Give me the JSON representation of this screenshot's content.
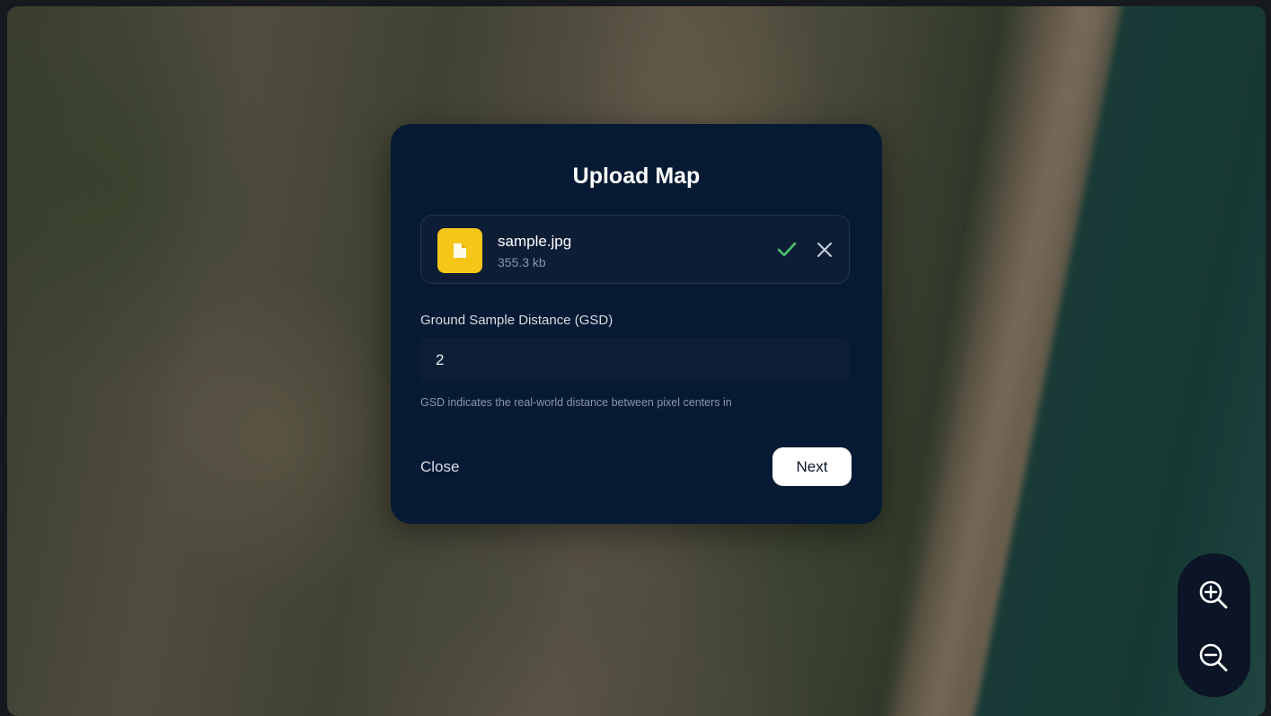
{
  "modal": {
    "title": "Upload Map",
    "file": {
      "name": "sample.jpg",
      "size": "355.3 kb",
      "thumb_color": "#f5c518",
      "status_icon": "check-icon",
      "remove_icon": "close-icon"
    },
    "gsd": {
      "label": "Ground Sample Distance (GSD)",
      "value": "2",
      "helper": "GSD indicates the real-world distance between pixel centers in"
    },
    "close_label": "Close",
    "next_label": "Next"
  },
  "map_controls": {
    "zoom_in_icon": "zoom-in-icon",
    "zoom_out_icon": "zoom-out-icon"
  },
  "colors": {
    "modal_bg": "#071a33",
    "accent_check": "#4cc26a",
    "button_bg": "#ffffff"
  }
}
